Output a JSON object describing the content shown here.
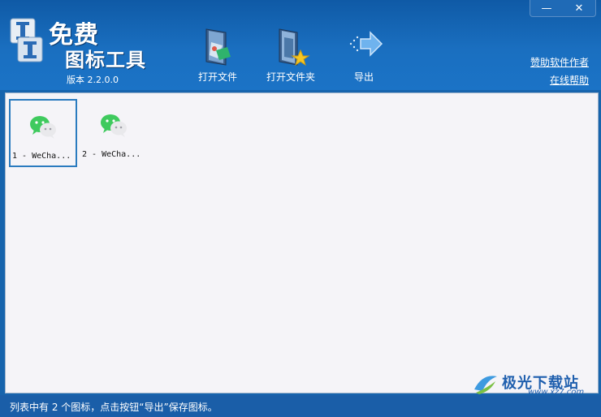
{
  "window": {
    "minimize_label": "—",
    "close_label": "✕"
  },
  "app": {
    "title_line1": "免费",
    "title_line2": "图标工具",
    "version": "版本 2.2.0.0"
  },
  "toolbar": {
    "open_file": "打开文件",
    "open_folder": "打开文件夹",
    "export": "导出"
  },
  "links": {
    "sponsor": "赞助软件作者",
    "help": "在线帮助"
  },
  "icons": [
    {
      "caption": "1 - WeCha...",
      "selected": true,
      "icon": "wechat-icon"
    },
    {
      "caption": "2 - WeCha...",
      "selected": false,
      "icon": "wechat-icon"
    }
  ],
  "status": {
    "text": "列表中有 2 个图标，点击按钮“导出”保存图标。"
  },
  "watermark": {
    "title": "极光下载站",
    "url": "www.xz7.com"
  },
  "colors": {
    "header": "#1764ad",
    "content_bg": "#f5f4f8",
    "wechat_green": "#3fca5e",
    "selection_border": "#2a7bbf"
  }
}
